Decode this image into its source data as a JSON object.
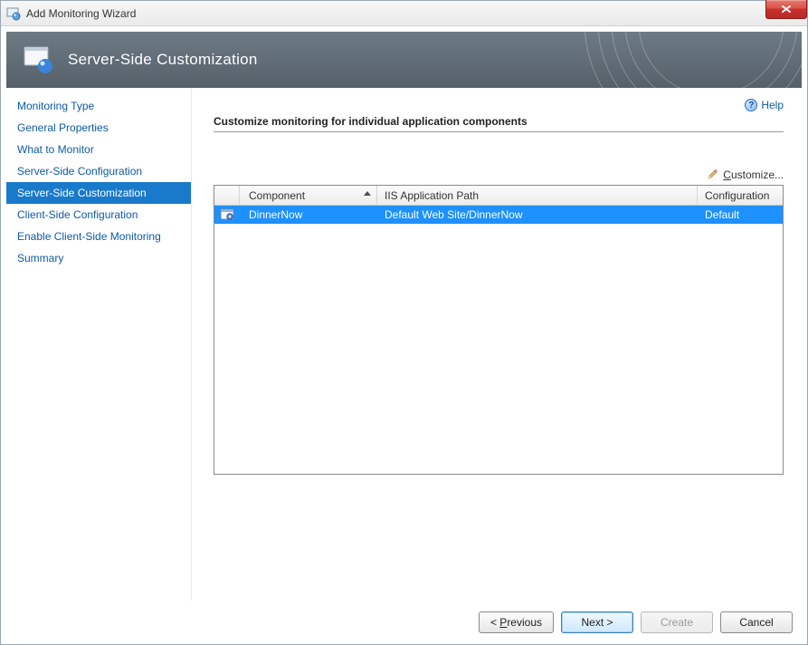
{
  "window": {
    "title": "Add Monitoring Wizard"
  },
  "banner": {
    "title": "Server-Side Customization"
  },
  "help": {
    "label": "Help"
  },
  "sidebar": {
    "items": [
      {
        "label": "Monitoring Type"
      },
      {
        "label": "General Properties"
      },
      {
        "label": "What to Monitor"
      },
      {
        "label": "Server-Side Configuration"
      },
      {
        "label": "Server-Side Customization"
      },
      {
        "label": "Client-Side Configuration"
      },
      {
        "label": "Enable Client-Side Monitoring"
      },
      {
        "label": "Summary"
      }
    ],
    "active_index": 4
  },
  "main": {
    "section_title": "Customize monitoring for individual application components",
    "customize_label_prefix": "C",
    "customize_label_rest": "ustomize..."
  },
  "table": {
    "columns": {
      "component": "Component",
      "iis_path": "IIS Application Path",
      "configuration": "Configuration"
    },
    "rows": [
      {
        "component": "DinnerNow",
        "iis_path": "Default Web Site/DinnerNow",
        "configuration": "Default"
      }
    ]
  },
  "footer": {
    "previous_accel": "P",
    "previous_rest": "revious",
    "next_label": "Next >",
    "create_label": "Create",
    "cancel_label": "Cancel"
  }
}
